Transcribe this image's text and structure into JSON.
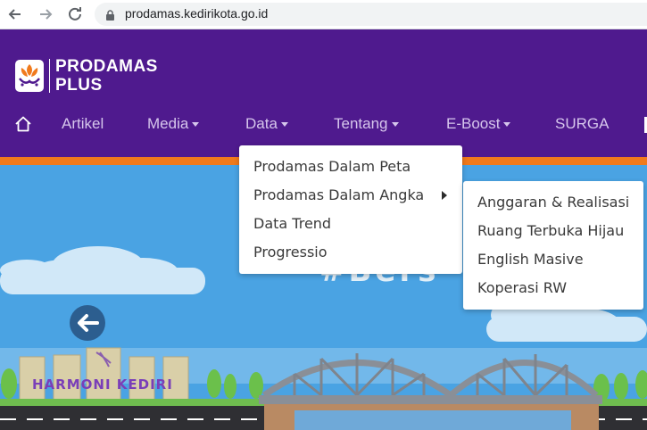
{
  "browser": {
    "url": "prodamas.kedirikota.go.id",
    "icons": [
      "back-arrow-icon",
      "forward-arrow-icon",
      "reload-icon",
      "lock-icon"
    ]
  },
  "header": {
    "logo_line1": "PRODAMAS",
    "logo_line2": "PLUS",
    "nav": {
      "items": [
        {
          "label": "Artikel",
          "has_caret": false
        },
        {
          "label": "Media",
          "has_caret": true
        },
        {
          "label": "Data",
          "has_caret": true
        },
        {
          "label": "Tentang",
          "has_caret": true
        },
        {
          "label": "E-Boost",
          "has_caret": true
        },
        {
          "label": "SURGA",
          "has_caret": false
        }
      ]
    }
  },
  "data_menu": {
    "items": [
      "Prodamas Dalam Peta",
      "Prodamas Dalam Angka",
      "Data Trend",
      "Progressio"
    ]
  },
  "angka_submenu": {
    "items": [
      "Anggaran & Realisasi",
      "Ruang Terbuka Hijau",
      "English Masive",
      "Koperasi RW"
    ]
  },
  "hero": {
    "banner_text": "#Bers",
    "monument_text": "HARMONI KEDIRI"
  },
  "colors": {
    "header_purple": "#4f1a8e",
    "accent_orange": "#f07a1c",
    "sky_blue": "#4aa3e3",
    "nav_text": "#d6c6ec"
  }
}
